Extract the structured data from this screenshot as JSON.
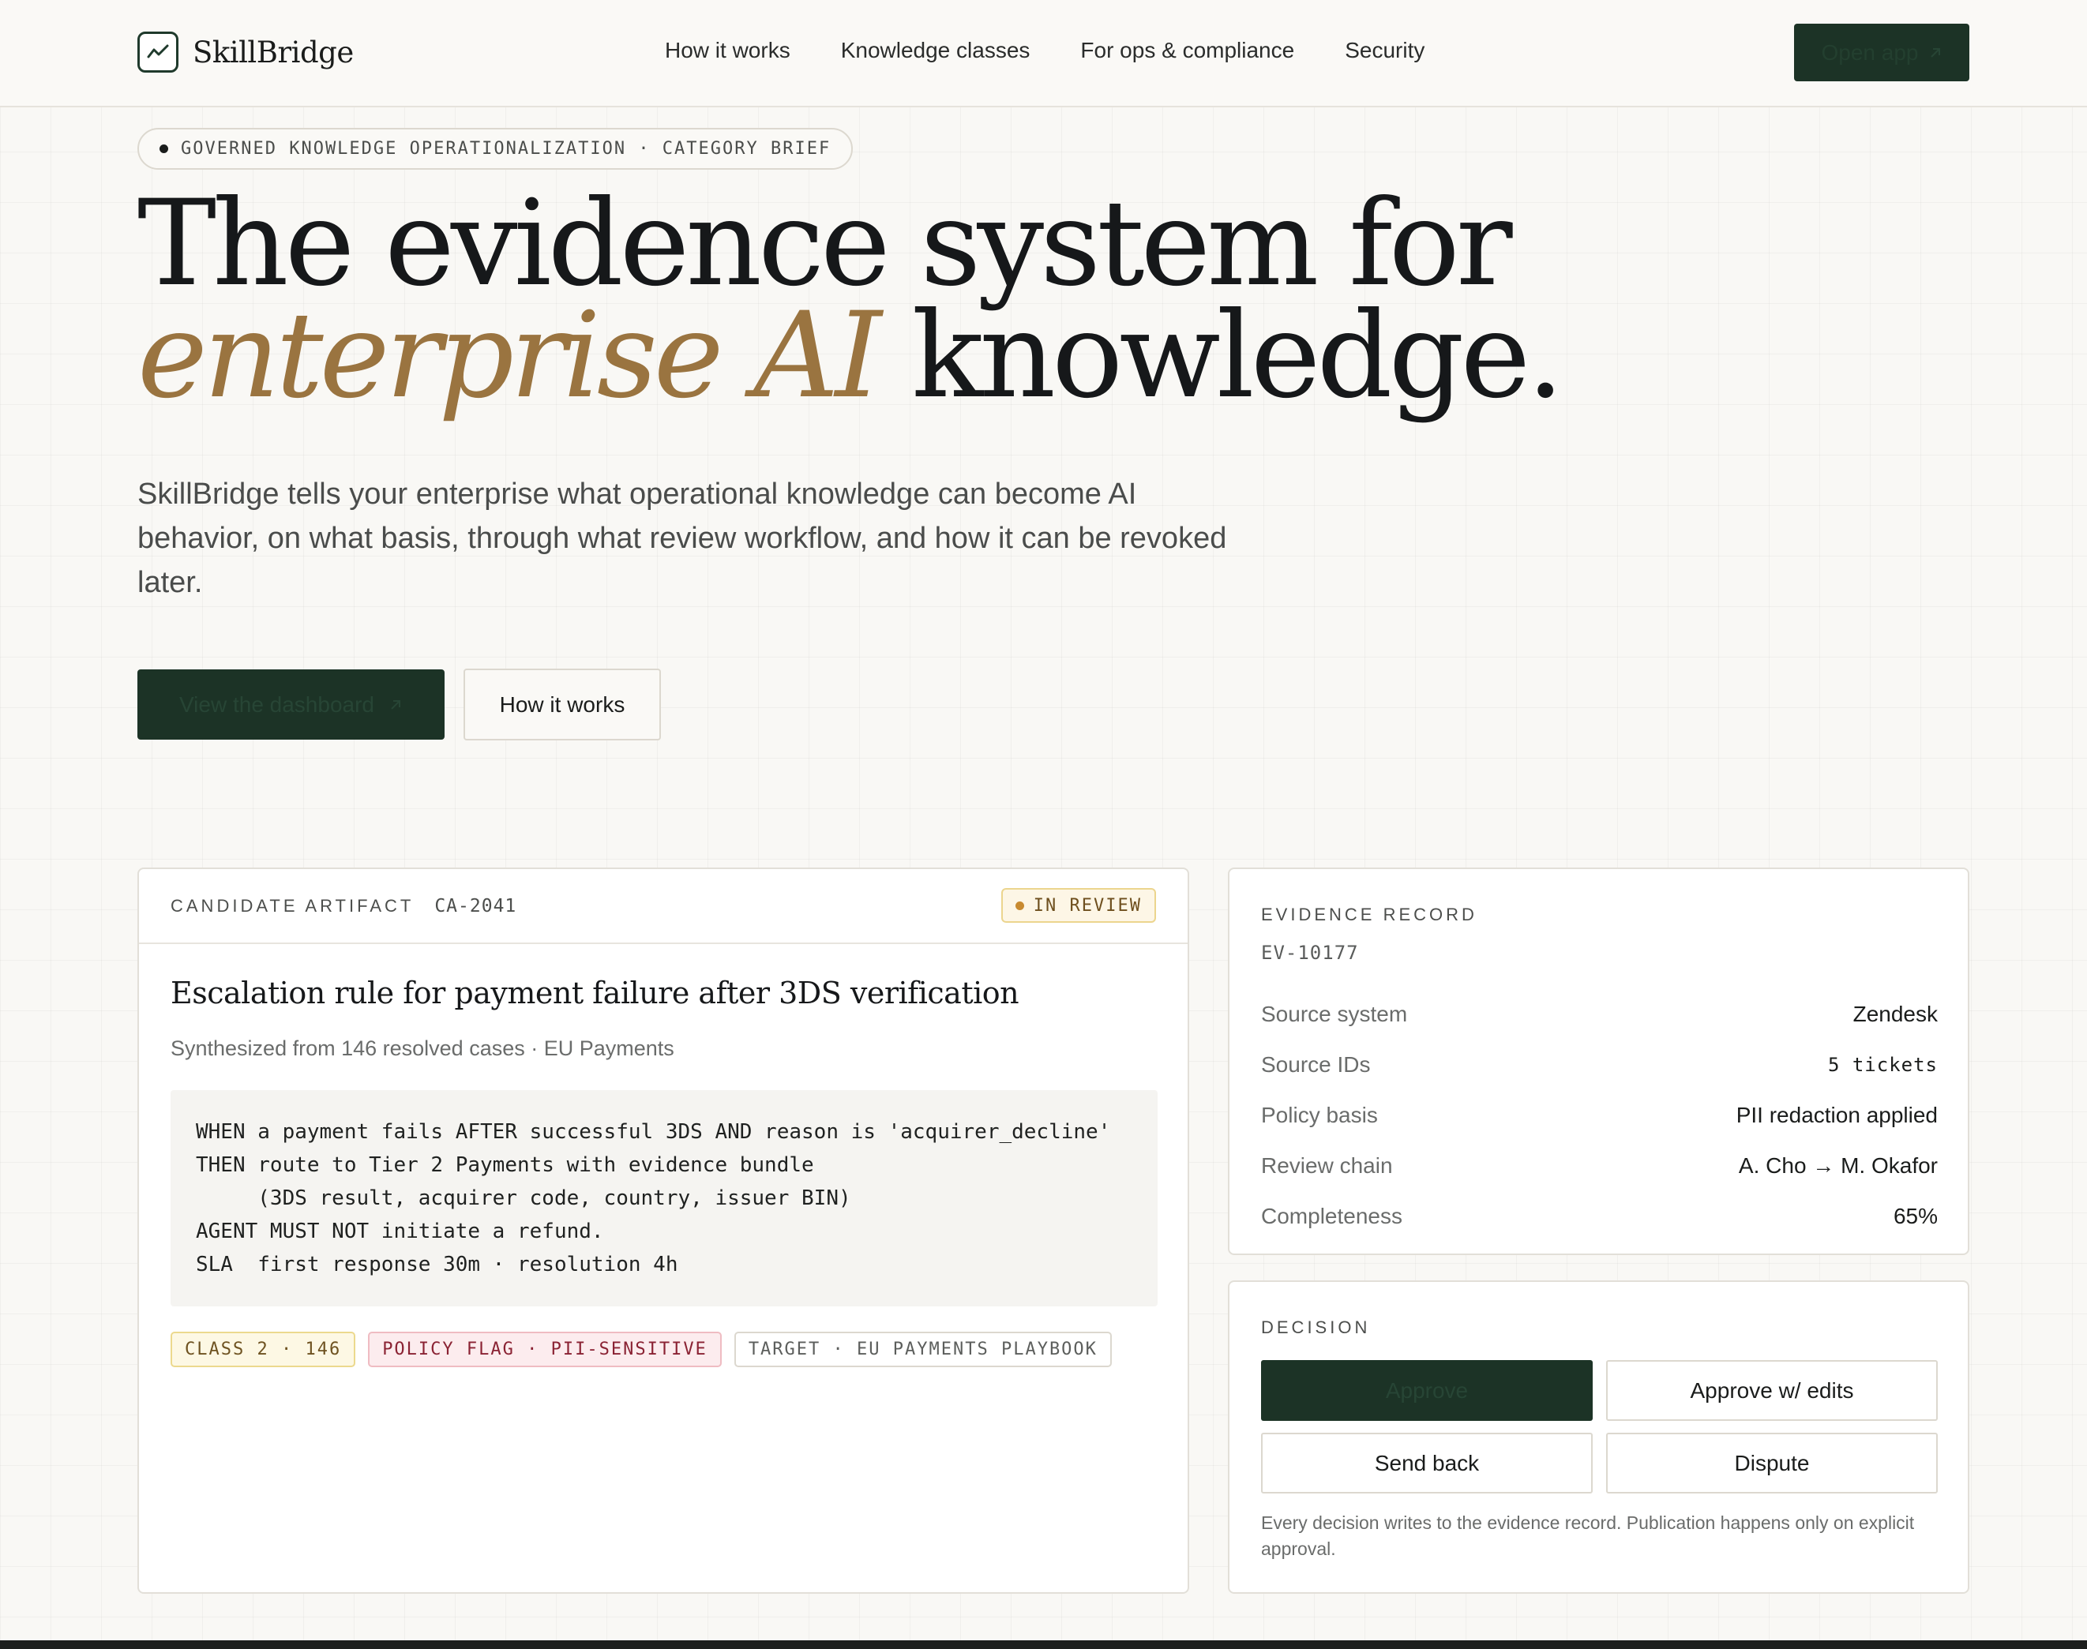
{
  "nav": {
    "brand": "SkillBridge",
    "links": [
      "How it works",
      "Knowledge classes",
      "For ops & compliance",
      "Security"
    ],
    "cta": "Open app",
    "cta_icon": "arrow-up-right-icon"
  },
  "hero": {
    "eyebrow": "GOVERNED KNOWLEDGE OPERATIONALIZATION · CATEGORY BRIEF",
    "headline_line1": "The evidence system for",
    "headline_accent": "enterprise AI",
    "headline_rest": " knowledge.",
    "lede": "SkillBridge tells your enterprise what operational knowledge can become AI behavior, on what basis, through what review workflow, and how it can be revoked later.",
    "primary_cta": "View the dashboard",
    "secondary_cta": "How it works",
    "accent_color": "#9a7440"
  },
  "artifact": {
    "label": "CANDIDATE ARTIFACT",
    "id": "CA-2041",
    "status": "IN REVIEW",
    "title": "Escalation rule for payment failure after 3DS verification",
    "subtitle": "Synthesized from 146 resolved cases · EU Payments",
    "code": "WHEN a payment fails AFTER successful 3DS AND reason is 'acquirer_decline'\nTHEN route to Tier 2 Payments with evidence bundle\n     (3DS result, acquirer code, country, issuer BIN)\nAGENT MUST NOT initiate a refund.\nSLA  first response 30m · resolution 4h",
    "tags": {
      "class": "CLASS 2 · 146",
      "policy": "POLICY FLAG · PII-SENSITIVE",
      "target": "TARGET · EU PAYMENTS PLAYBOOK"
    }
  },
  "evidence": {
    "label": "EVIDENCE RECORD",
    "id": "EV-10177",
    "rows": [
      {
        "k": "Source system",
        "v": "Zendesk"
      },
      {
        "k": "Source IDs",
        "v": "5 tickets"
      },
      {
        "k": "Policy basis",
        "v": "PII redaction applied"
      },
      {
        "k": "Review chain",
        "v": "A. Cho → M. Okafor"
      },
      {
        "k": "Completeness",
        "v": "65%"
      }
    ]
  },
  "decision": {
    "label": "DECISION",
    "approve": "Approve",
    "approve_edits": "Approve w/ edits",
    "send_back": "Send back",
    "dispute": "Dispute",
    "note": "Every decision writes to the evidence record. Publication happens only on explicit approval."
  }
}
